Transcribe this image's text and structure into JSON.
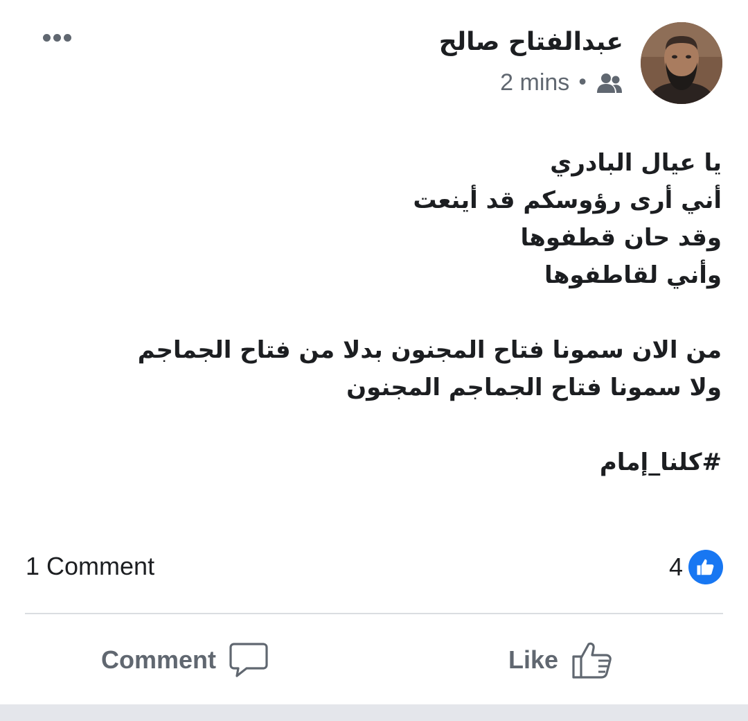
{
  "post": {
    "author": "عبدالفتاح صالح",
    "time": "2 mins",
    "separator": "•",
    "audience_icon": "friends-icon",
    "lines": [
      "يا عيال البادري",
      "أني أرى رؤوسكم قد أينعت",
      "وقد حان قطفوها",
      "وأني لقاطفوها",
      "",
      "من الان سمونا فتاح المجنون بدلا من فتاح الجماجم",
      "ولا سمونا فتاح الجماجم المجنون",
      "",
      "#كلنا_إمام"
    ]
  },
  "stats": {
    "comments": "1 Comment",
    "likes": "4"
  },
  "actions": {
    "comment_label": "Comment",
    "like_label": "Like"
  },
  "colors": {
    "accent": "#1877f2",
    "text": "#1c1e21",
    "secondary": "#606770",
    "divider": "#dadde1"
  }
}
